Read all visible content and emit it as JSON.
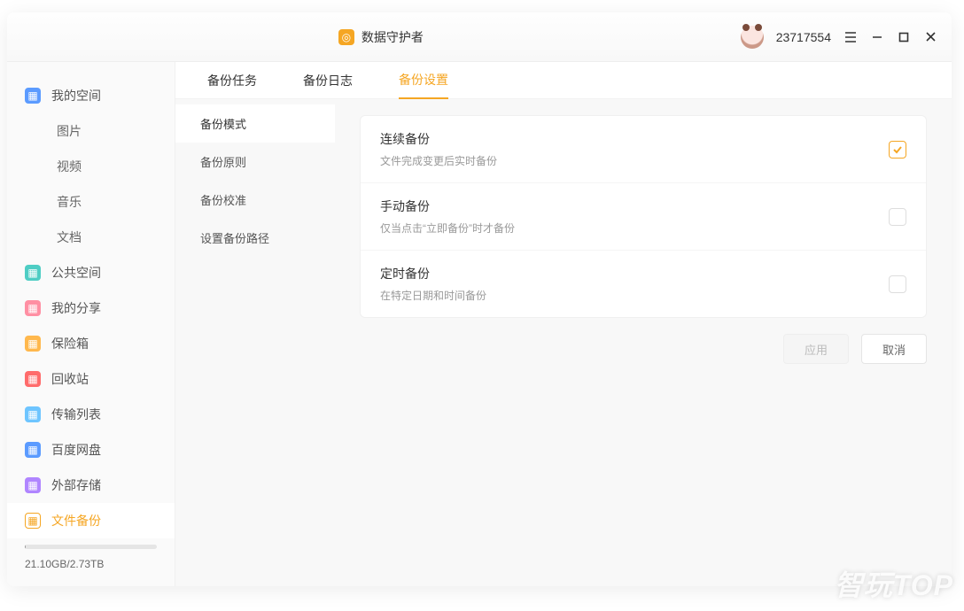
{
  "titlebar": {
    "app_name": "数据守护者",
    "user_id": "23717554"
  },
  "sidebar": {
    "items": [
      {
        "label": "我的空间",
        "icon": "ic-blue"
      },
      {
        "label": "图片",
        "sub": true
      },
      {
        "label": "视频",
        "sub": true
      },
      {
        "label": "音乐",
        "sub": true
      },
      {
        "label": "文档",
        "sub": true
      },
      {
        "label": "公共空间",
        "icon": "ic-teal"
      },
      {
        "label": "我的分享",
        "icon": "ic-pink"
      },
      {
        "label": "保险箱",
        "icon": "ic-orange"
      },
      {
        "label": "回收站",
        "icon": "ic-red"
      },
      {
        "label": "传输列表",
        "icon": "ic-cyan"
      },
      {
        "label": "百度网盘",
        "icon": "ic-blue"
      },
      {
        "label": "外部存储",
        "icon": "ic-violet"
      },
      {
        "label": "文件备份",
        "icon": "ic-accent",
        "active": true
      }
    ],
    "storage": "21.10GB/2.73TB"
  },
  "tabs": [
    {
      "label": "备份任务"
    },
    {
      "label": "备份日志"
    },
    {
      "label": "备份设置",
      "active": true
    }
  ],
  "subnav": [
    {
      "label": "备份模式",
      "active": true
    },
    {
      "label": "备份原则"
    },
    {
      "label": "备份校准"
    },
    {
      "label": "设置备份路径"
    }
  ],
  "options": [
    {
      "title": "连续备份",
      "desc": "文件完成变更后实时备份",
      "checked": true
    },
    {
      "title": "手动备份",
      "desc": "仅当点击“立即备份”时才备份",
      "checked": false
    },
    {
      "title": "定时备份",
      "desc": "在特定日期和时间备份",
      "checked": false
    }
  ],
  "actions": {
    "apply": "应用",
    "cancel": "取消"
  },
  "watermark": "智玩TOP"
}
